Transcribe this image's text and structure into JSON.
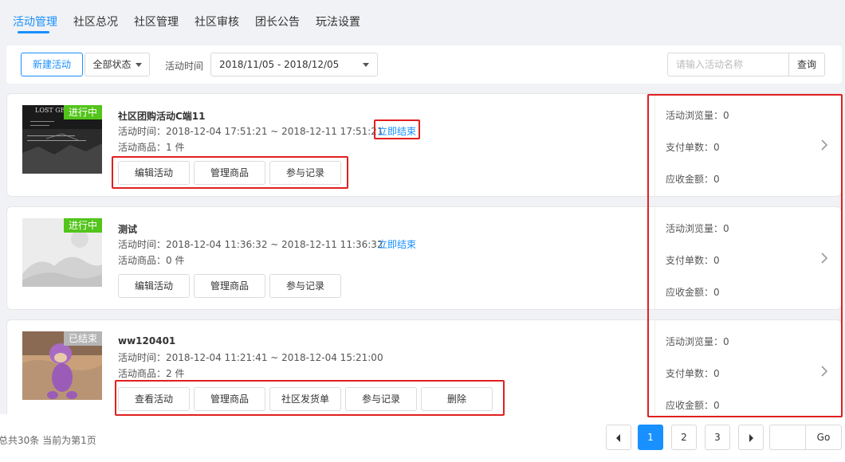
{
  "tabs": [
    {
      "label": "活动管理",
      "active": true
    },
    {
      "label": "社区总况"
    },
    {
      "label": "社区管理"
    },
    {
      "label": "社区审核"
    },
    {
      "label": "团长公告"
    },
    {
      "label": "玩法设置"
    }
  ],
  "toolbar": {
    "new_label": "新建活动",
    "status_select": "全部状态",
    "time_label": "活动时间",
    "date_range": "2018/11/05 - 2018/12/05",
    "search_placeholder": "请输入活动名称",
    "search_button": "查询"
  },
  "activities": [
    {
      "status": "进行中",
      "status_type": "running",
      "thumb_text": "LOST GE",
      "title": "社区团购活动C端11",
      "time": "活动时间：2018-12-04 17:51:21 ~ 2018-12-11 17:51:21",
      "end_link": "立即结束",
      "goods": "活动商品：1 件",
      "buttons": [
        "编辑活动",
        "管理商品",
        "参与记录"
      ],
      "stats": {
        "views": "活动浏览量：0",
        "orders": "支付单数：0",
        "amount": "应收金额：0"
      }
    },
    {
      "status": "进行中",
      "status_type": "running",
      "title": "测试",
      "time": "活动时间：2018-12-04 11:36:32 ~ 2018-12-11 11:36:32",
      "end_link": "立即结束",
      "goods": "活动商品：0 件",
      "buttons": [
        "编辑活动",
        "管理商品",
        "参与记录"
      ],
      "stats": {
        "views": "活动浏览量：0",
        "orders": "支付单数：0",
        "amount": "应收金额：0"
      }
    },
    {
      "status": "已结束",
      "status_type": "ended",
      "title": "ww120401",
      "time": "活动时间：2018-12-04 11:21:41 ~ 2018-12-04 15:21:00",
      "goods": "活动商品：2 件",
      "buttons": [
        "查看活动",
        "管理商品",
        "社区发货单",
        "参与记录",
        "删除"
      ],
      "stats": {
        "views": "活动浏览量：0",
        "orders": "支付单数：0",
        "amount": "应收金额：0"
      }
    }
  ],
  "pagination": {
    "summary": "总共30条 当前为第1页",
    "pages": [
      "1",
      "2",
      "3"
    ],
    "current": "1",
    "go_label": "Go"
  },
  "colors": {
    "accent": "#1890ff",
    "running": "#52c41a",
    "ended": "#b5b5b5",
    "highlight": "#e02020"
  }
}
